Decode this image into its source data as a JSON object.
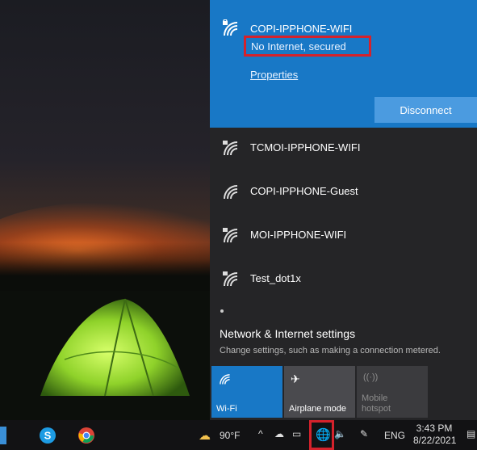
{
  "active_network": {
    "ssid": "COPI-IPPHONE-WIFI",
    "status": "No Internet, secured",
    "properties_link": "Properties",
    "disconnect_button": "Disconnect"
  },
  "networks": [
    {
      "ssid": "TCMOI-IPPHONE-WIFI",
      "secured": true
    },
    {
      "ssid": "COPI-IPPHONE-Guest",
      "secured": false
    },
    {
      "ssid": "MOI-IPPHONE-WIFI",
      "secured": true
    },
    {
      "ssid": "Test_dot1x",
      "secured": true
    }
  ],
  "settings": {
    "title": "Network & Internet settings",
    "subtitle": "Change settings, such as making a connection metered."
  },
  "quick_actions": [
    {
      "label": "Wi-Fi",
      "active": true
    },
    {
      "label": "Airplane mode",
      "active": false
    },
    {
      "label": "Mobile hotspot",
      "active": false,
      "disabled": true
    }
  ],
  "taskbar": {
    "weather_temp": "90°F",
    "language": "ENG",
    "time": "3:43 PM",
    "date": "8/22/2021"
  },
  "colors": {
    "accent": "#1878c6",
    "flyout_bg": "#252527",
    "highlight_box": "#d4222c"
  }
}
